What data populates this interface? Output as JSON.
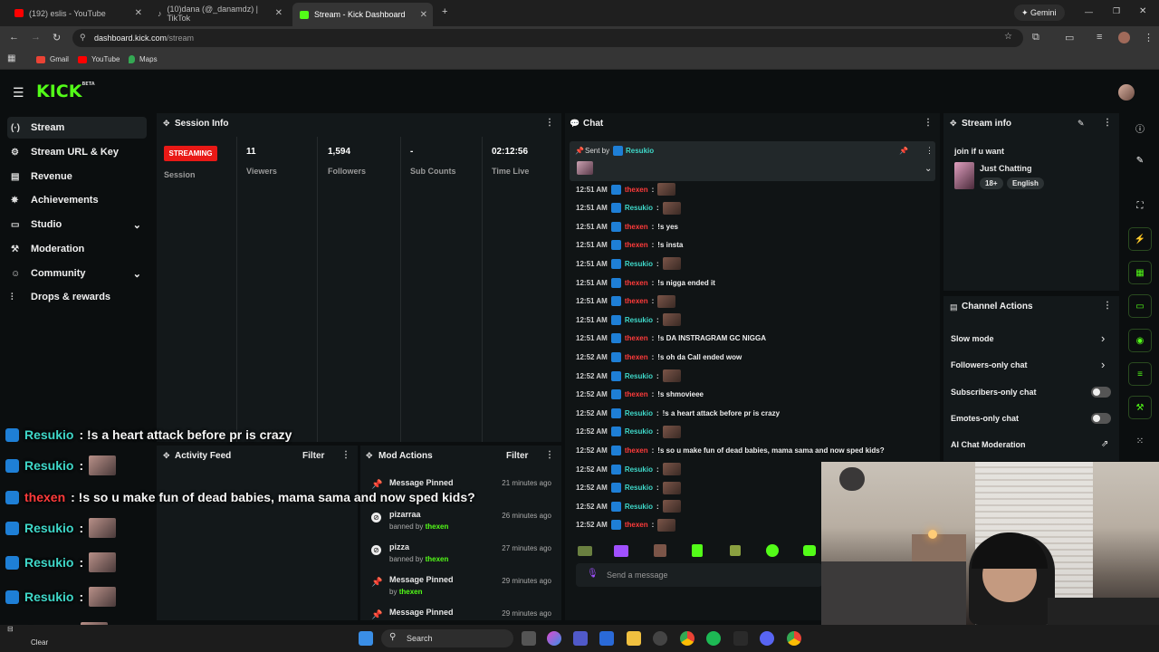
{
  "browser": {
    "tabs": [
      {
        "label": "(192) eslis - YouTube",
        "color": "#ff0000"
      },
      {
        "label": "(10)dana (@_danamdz) | TikTok",
        "color": "#ffffff"
      },
      {
        "label": "Stream - Kick Dashboard",
        "color": "#53fc18"
      }
    ],
    "gemini": "Gemini",
    "url_host": "dashboard.kick.com",
    "url_path": "/stream",
    "bookmarks": [
      "Gmail",
      "YouTube",
      "Maps"
    ]
  },
  "kick": {
    "logo": "KICK",
    "beta": "BETA"
  },
  "sidebar": {
    "items": [
      {
        "label": "Stream",
        "icon": "(·)"
      },
      {
        "label": "Stream URL & Key",
        "icon": "⚙"
      },
      {
        "label": "Revenue",
        "icon": "▤"
      },
      {
        "label": "Achievements",
        "icon": "✸"
      },
      {
        "label": "Studio",
        "icon": "▭"
      },
      {
        "label": "Moderation",
        "icon": "🔧"
      },
      {
        "label": "Community",
        "icon": "👥"
      },
      {
        "label": "Drops & rewards",
        "icon": "⫶"
      }
    ]
  },
  "session": {
    "title": "Session Info",
    "status": "STREAMING",
    "status_label": "Session",
    "viewers": "11",
    "viewers_label": "Viewers",
    "followers": "1,594",
    "followers_label": "Followers",
    "subs": "-",
    "subs_label": "Sub Counts",
    "time": "02:12:56",
    "time_label": "Time Live"
  },
  "activity": {
    "title": "Activity Feed",
    "filter": "Filter"
  },
  "mod": {
    "title": "Mod Actions",
    "filter": "Filter",
    "items": [
      {
        "action": "Message Pinned",
        "by": "",
        "user": "",
        "time": "21 minutes ago"
      },
      {
        "action": "pizarraa",
        "by": "banned by",
        "user": "thexen",
        "time": "26 minutes ago"
      },
      {
        "action": "pizza",
        "by": "banned by",
        "user": "thexen",
        "time": "27 minutes ago"
      },
      {
        "action": "Message Pinned",
        "by": "by",
        "user": "thexen",
        "time": "29 minutes ago"
      },
      {
        "action": "Message Pinned",
        "by": "",
        "user": "",
        "time": "29 minutes ago"
      }
    ]
  },
  "chat": {
    "title": "Chat",
    "pinned_sent_by": "Sent by",
    "pinned_user": "Resukio",
    "placeholder": "Send a message",
    "messages": [
      {
        "time": "12:51 AM",
        "user": "thexen",
        "text": "",
        "emote": true,
        "color": "red"
      },
      {
        "time": "12:51 AM",
        "user": "Resukio",
        "text": "",
        "emote": true,
        "color": "blue"
      },
      {
        "time": "12:51 AM",
        "user": "thexen",
        "text": "!s yes",
        "emote": false,
        "color": "red"
      },
      {
        "time": "12:51 AM",
        "user": "thexen",
        "text": "!s insta",
        "emote": false,
        "color": "red"
      },
      {
        "time": "12:51 AM",
        "user": "Resukio",
        "text": "",
        "emote": true,
        "color": "blue"
      },
      {
        "time": "12:51 AM",
        "user": "thexen",
        "text": "!s nigga ended it",
        "emote": false,
        "color": "red"
      },
      {
        "time": "12:51 AM",
        "user": "thexen",
        "text": "",
        "emote": true,
        "color": "red"
      },
      {
        "time": "12:51 AM",
        "user": "Resukio",
        "text": "",
        "emote": true,
        "color": "blue"
      },
      {
        "time": "12:51 AM",
        "user": "thexen",
        "text": "!s DA INSTRAGRAM GC NIGGA",
        "emote": false,
        "color": "red"
      },
      {
        "time": "12:52 AM",
        "user": "thexen",
        "text": "!s oh da Call ended wow",
        "emote": false,
        "color": "red"
      },
      {
        "time": "12:52 AM",
        "user": "Resukio",
        "text": "",
        "emote": true,
        "color": "blue"
      },
      {
        "time": "12:52 AM",
        "user": "thexen",
        "text": "!s shmovieee",
        "emote": false,
        "color": "red"
      },
      {
        "time": "12:52 AM",
        "user": "Resukio",
        "text": "!s a heart attack before pr is crazy",
        "emote": false,
        "color": "blue"
      },
      {
        "time": "12:52 AM",
        "user": "Resukio",
        "text": "",
        "emote": true,
        "color": "blue"
      },
      {
        "time": "12:52 AM",
        "user": "thexen",
        "text": "!s so u make fun of dead babies, mama sama and now sped kids?",
        "emote": false,
        "color": "red"
      },
      {
        "time": "12:52 AM",
        "user": "Resukio",
        "text": "",
        "emote": true,
        "color": "blue"
      },
      {
        "time": "12:52 AM",
        "user": "Resukio",
        "text": "",
        "emote": true,
        "color": "blue"
      },
      {
        "time": "12:52 AM",
        "user": "Resukio",
        "text": "",
        "emote": true,
        "color": "blue"
      },
      {
        "time": "12:52 AM",
        "user": "thexen",
        "text": "",
        "emote": true,
        "color": "red"
      }
    ]
  },
  "stream_info": {
    "title": "Stream info",
    "stream_title": "join if u want",
    "category": "Just Chatting",
    "tags": [
      "18+",
      "English"
    ]
  },
  "channel_actions": {
    "title": "Channel Actions",
    "items": [
      "Slow mode",
      "Followers-only chat",
      "Subscribers-only chat",
      "Emotes-only chat",
      "AI Chat Moderation"
    ]
  },
  "overlay": [
    {
      "user": "Resukio",
      "text": ": !s a heart attack before pr is crazy",
      "color": "blue",
      "emote": false
    },
    {
      "user": "Resukio",
      "text": ":",
      "color": "blue",
      "emote": true
    },
    {
      "user": "thexen",
      "text": ": !s so u make fun of dead babies, mama sama and now sped kids?",
      "color": "red",
      "emote": false
    },
    {
      "user": "Resukio",
      "text": ":",
      "color": "blue",
      "emote": true
    },
    {
      "user": "Resukio",
      "text": ":",
      "color": "blue",
      "emote": true
    },
    {
      "user": "Resukio",
      "text": ":",
      "color": "blue",
      "emote": true
    },
    {
      "user": "thexen",
      "text": ":",
      "color": "red",
      "emote": true
    }
  ],
  "taskbar": {
    "search": "Search",
    "clear": "Clear"
  },
  "colors": {
    "accent": "#53fc18",
    "live": "#e91916",
    "panel": "#13181a",
    "user_blue": "#3fd8c9",
    "user_red": "#ff3b3b"
  }
}
